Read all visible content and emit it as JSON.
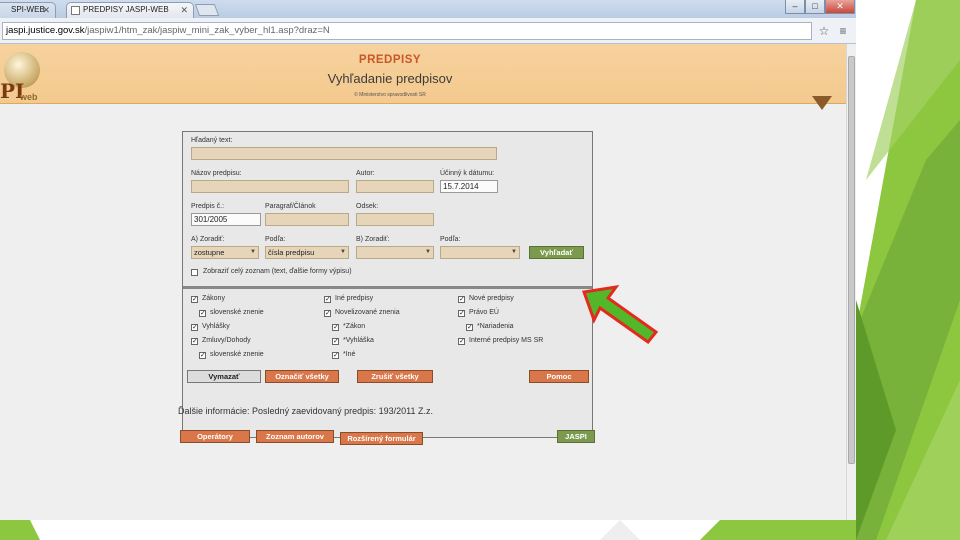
{
  "browser": {
    "tabs": [
      {
        "title": "SPI-WEB",
        "active": false
      },
      {
        "title": "PREDPISY JASPI-WEB",
        "active": true
      }
    ],
    "new_tab_icon": "new-tab-icon",
    "window_controls": {
      "minimize": "–",
      "maximize": "□",
      "close": "✕"
    },
    "url_host": "jaspi.justice.gov.sk",
    "url_path": "/jaspiw1/htm_zak/jaspiw_mini_zak_vyber_hl1.asp?draz=N",
    "star_icon": "☆",
    "menu_icon": "≡"
  },
  "header": {
    "title": "PREDPISY",
    "subtitle": "Vyhľadanie predpisov",
    "copyright": "© Ministerstvo spravodlivosti SR",
    "logo_text": "PI",
    "logo_web": "web"
  },
  "form": {
    "hladany_text_label": "Hľadaný text:",
    "hladany_text_value": "",
    "nazov_label": "Názov predpisu:",
    "nazov_value": "",
    "autor_label": "Autor:",
    "autor_value": "",
    "ucinny_label": "Účinný k dátumu:",
    "ucinny_value": "15.7.2014",
    "predpis_label": "Predpis č.:",
    "predpis_value": "301/2005",
    "paragraf_label": "Paragraf/Článok",
    "paragraf_value": "",
    "odsek_label": "Odsek:",
    "odsek_value": "",
    "a_zoradit_label": "A) Zoradiť:",
    "a_zoradit_value": "zostupne",
    "a_podla_label": "Podľa:",
    "a_podla_value": "čísla predpisu",
    "b_zoradit_label": "B) Zoradiť:",
    "b_zoradit_value": "",
    "b_podla_label": "Podľa:",
    "b_podla_value": "",
    "search_button": "Vyhľadať",
    "show_all_label": "Zobraziť celý zoznam (text, ďalšie formy výpisu)",
    "checkboxes": {
      "zakony": "Zákony",
      "slovenske_znenie_1": "slovenské znenie",
      "vyhlasky": "Vyhlášky",
      "zmluvy": "Zmluvy/Dohody",
      "slovenske_znenie_2": "slovenské znenie",
      "ine_predpisy": "Iné predpisy",
      "novelizovane": "Novelizované znenia",
      "zakon_star": "*Zákon",
      "vyhlaska_star": "*Vyhláška",
      "ine_star": "*Iné",
      "nove_predpisy": "Nové predpisy",
      "pravo_eu": "Právo EÚ",
      "nariadenia": "*Nariadenia",
      "interne": "Interné predpisy MS SR"
    },
    "buttons": {
      "vymazat": "Vymazať",
      "oznacit": "Označiť všetky",
      "zrusit": "Zrušiť všetky",
      "pomoc": "Pomoc"
    }
  },
  "info": {
    "label": "Ďalšie informácie:",
    "text": "Posledný zaevidovaný predpis: 193/2011 Z.z."
  },
  "bottom_buttons": {
    "operatory": "Operátory",
    "zoznam_autorov": "Zoznam autorov",
    "rozsireny": "Rozšírený formulár",
    "jaspi": "JASPI"
  },
  "colors": {
    "header_bg": "#f3c98e",
    "input_bg": "#e6d5b8",
    "button_orange": "#d9774a",
    "button_green": "#7c9a4e",
    "arrow_green": "#52b82a",
    "arrow_red": "#e22a1f",
    "slide_green": "#8dc63f"
  }
}
